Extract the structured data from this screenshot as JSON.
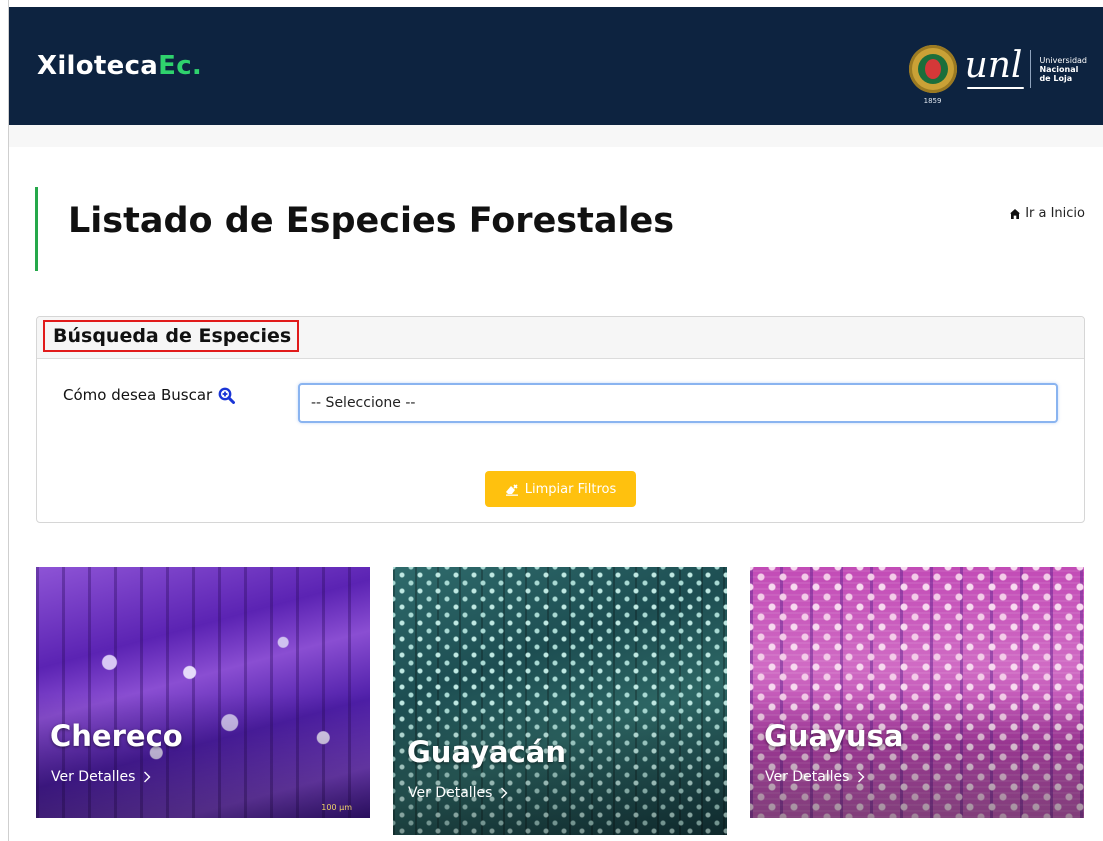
{
  "header": {
    "brand_main": "Xiloteca",
    "brand_accent": "Ec.",
    "logo_seal_year": "1859",
    "logo_unl": "unl",
    "logo_uni_line1": "Universidad",
    "logo_uni_line2": "Nacional",
    "logo_uni_line3": "de Loja"
  },
  "page": {
    "title": "Listado de Especies Forestales",
    "home_link": "Ir a Inicio"
  },
  "search": {
    "card_title": "Búsqueda de Especies",
    "label": "Cómo desea Buscar",
    "select_value": "-- Seleccione --",
    "clear_button": "Limpiar Filtros"
  },
  "species": [
    {
      "name": "Chereco",
      "link": "Ver Detalles",
      "scale": "100 µm"
    },
    {
      "name": "Guayacán",
      "link": "Ver Detalles",
      "scale": ""
    },
    {
      "name": "Guayusa",
      "link": "Ver Detalles",
      "scale": ""
    }
  ],
  "colors": {
    "topbar": "#0d2340",
    "brand_accent": "#2fd26d",
    "title_accent": "#25a84a",
    "button": "#ffc10e",
    "highlight_box": "#e11b1b"
  }
}
